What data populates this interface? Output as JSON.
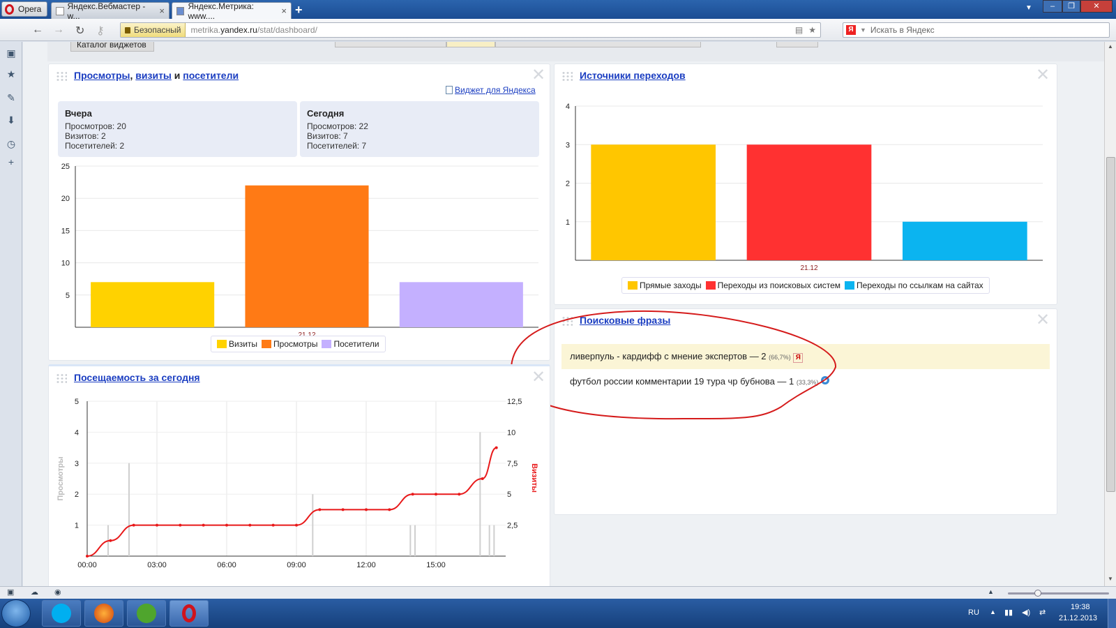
{
  "browser": {
    "opera_label": "Opera",
    "tabs": [
      {
        "label": "Яндекс.Вебмастер - w..."
      },
      {
        "label": "Яндекс.Метрика: www...."
      }
    ],
    "secure_label": "Безопасный",
    "url_prefix": "metrika.",
    "url_domain": "yandex.ru",
    "url_path": "/stat/dashboard/",
    "search_placeholder": "Искать в Яндекс"
  },
  "toolbar": {
    "catalog_label": "Каталог виджетов"
  },
  "widget_visits": {
    "title_part1": "Просмотры",
    "title_sep1": ", ",
    "title_part2": "визиты",
    "title_sep2": " и ",
    "title_part3": "посетители",
    "widget_link": "Виджет для Яндекса",
    "yesterday": {
      "heading": "Вчера",
      "views": "Просмотров: 20",
      "visits": "Визитов: 2",
      "visitors": "Посетителей: 2"
    },
    "today": {
      "heading": "Сегодня",
      "views": "Просмотров: 22",
      "visits": "Визитов: 7",
      "visitors": "Посетителей: 7"
    },
    "legend": [
      "Визиты",
      "Просмотры",
      "Посетители"
    ]
  },
  "widget_sources": {
    "title": "Источники переходов",
    "legend": [
      "Прямые заходы",
      "Переходы из поисковых систем",
      "Переходы по ссылкам на сайтах"
    ]
  },
  "widget_phrases": {
    "title": "Поисковые фразы",
    "items": [
      {
        "text": "ливерпуль - кардифф с мнение экспертов — 2",
        "pct": "(66,7%)",
        "engine_icon": "yandex-icon"
      },
      {
        "text": "футбол россии комментарии 19 тура чр бубнова — 1",
        "pct": "(33,3%)",
        "engine_icon": "rambler-icon"
      }
    ]
  },
  "widget_attendance": {
    "title": "Посещаемость за сегодня"
  },
  "chart_data": [
    {
      "type": "bar",
      "categories": [
        "21.12"
      ],
      "series": [
        {
          "name": "Визиты",
          "values": [
            7
          ],
          "color": "#ffd200"
        },
        {
          "name": "Просмотры",
          "values": [
            22
          ],
          "color": "#ff7a15"
        },
        {
          "name": "Посетители",
          "values": [
            7
          ],
          "color": "#c4b0ff"
        }
      ],
      "ylim": [
        0,
        25
      ],
      "yticks": [
        "5",
        "10",
        "15",
        "20",
        "25"
      ],
      "grid": true
    },
    {
      "type": "bar",
      "categories": [
        "21.12"
      ],
      "series": [
        {
          "name": "Прямые заходы",
          "values": [
            3
          ],
          "color": "#ffc600"
        },
        {
          "name": "Переходы из поисковых систем",
          "values": [
            3
          ],
          "color": "#ff3131"
        },
        {
          "name": "Переходы по ссылкам на сайтах",
          "values": [
            1
          ],
          "color": "#0bb4f0"
        }
      ],
      "ylim": [
        0,
        4
      ],
      "yticks": [
        "1",
        "2",
        "3",
        "4"
      ],
      "grid": true
    },
    {
      "type": "line",
      "ylabel": "Просмотры",
      "y2label": "Визиты",
      "xticks": [
        "00:00",
        "03:00",
        "06:00",
        "09:00",
        "12:00",
        "15:00"
      ],
      "yticks": [
        "1",
        "2",
        "3",
        "4",
        "5"
      ],
      "y2ticks": [
        "2,5",
        "5",
        "7,5",
        "10",
        "12,5"
      ],
      "ylim": [
        0,
        5
      ],
      "y2lim": [
        0,
        12.5
      ],
      "xlim_hours": [
        0,
        18
      ],
      "visits_series": {
        "name": "Визиты",
        "color": "#e8191a",
        "x_hours": [
          0,
          1,
          2,
          3,
          4,
          5,
          6,
          7,
          8,
          9,
          10,
          11,
          12,
          13,
          14,
          15,
          16,
          17,
          17.6
        ],
        "y": [
          0,
          1,
          2,
          2,
          2,
          2,
          2,
          2,
          2,
          2,
          3,
          3,
          3,
          3,
          4,
          4,
          4,
          5,
          7
        ]
      },
      "views_bars": {
        "name": "Просмотры",
        "x_hours": [
          0.9,
          1.8,
          9.7,
          13.9,
          14.1,
          16.9,
          17.3,
          17.5
        ],
        "y": [
          1,
          3,
          2,
          1,
          1,
          4,
          1,
          1
        ]
      }
    }
  ],
  "taskbar": {
    "lang": "RU",
    "time": "19:38",
    "date": "21.12.2013"
  }
}
